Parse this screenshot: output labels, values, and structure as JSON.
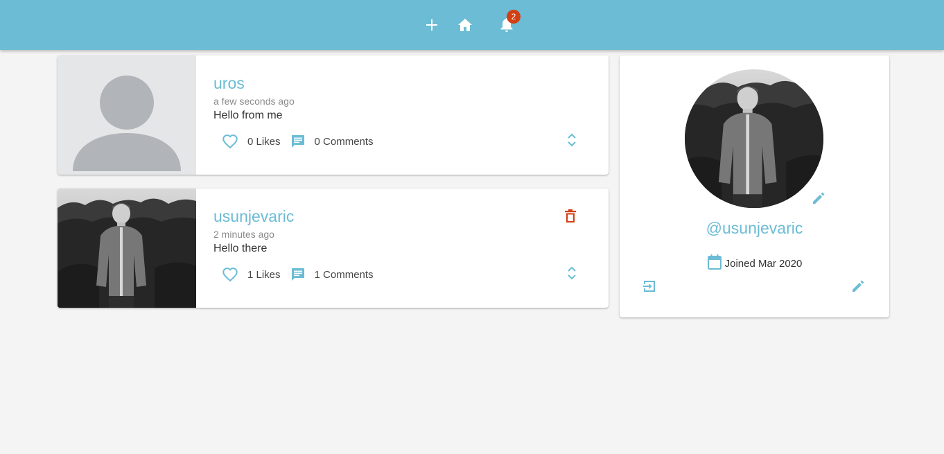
{
  "colors": {
    "appbar": "#6bbcd4",
    "accent": "#6bbcd4",
    "badge": "#d23f13",
    "delete": "#d23f13"
  },
  "navbar": {
    "add_icon": "plus-icon",
    "home_icon": "home-icon",
    "notifications_icon": "bell-icon",
    "notification_count": "2"
  },
  "posts": [
    {
      "username": "uros",
      "time": "a few seconds ago",
      "body": "Hello from me",
      "likes": "0 Likes",
      "comments": "0 Comments",
      "image": "default-avatar-placeholder",
      "deletable": false
    },
    {
      "username": "usunjevaric",
      "time": "2 minutes ago",
      "body": "Hello there",
      "likes": "1 Likes",
      "comments": "1 Comments",
      "image": "user-photo",
      "deletable": true
    }
  ],
  "profile": {
    "handle": "@usunjevaric",
    "joined": "Joined Mar 2020",
    "icons": {
      "calendar": "calendar-icon",
      "edit_photo": "pencil-icon",
      "logout": "logout-icon",
      "edit_profile": "pencil-icon"
    }
  }
}
